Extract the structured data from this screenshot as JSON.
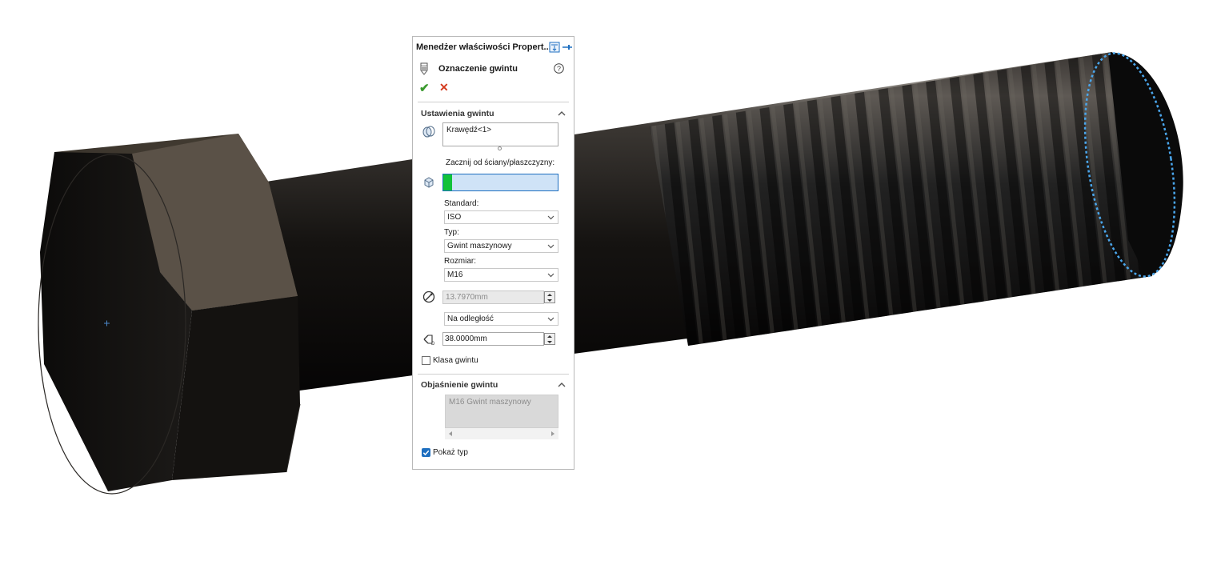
{
  "panel": {
    "title": "Menedżer właściwości Propert...",
    "feature_title": "Oznaczenie gwintu",
    "ok_label": "✔",
    "cancel_label": "✕",
    "thread_settings": {
      "section_title": "Ustawienia gwintu",
      "edge_selection": "Krawędź<1>",
      "start_label": "Zacznij od ściany/płaszczyzny:",
      "start_value": "",
      "standard_label": "Standard:",
      "standard_value": "ISO",
      "type_label": "Typ:",
      "type_value": "Gwint maszynowy",
      "size_label": "Rozmiar:",
      "size_value": "M16",
      "minor_diameter": "13.7970mm",
      "end_condition": "Na odległość",
      "depth": "38.0000mm",
      "class_label": "Klasa gwintu",
      "class_checked": false
    },
    "callout": {
      "section_title": "Objaśnienie gwintu",
      "text": "M16 Gwint maszynowy",
      "show_type_label": "Pokaż typ",
      "show_type_checked": true
    }
  },
  "colors": {
    "accent_blue": "#1e6fc0",
    "ok_green": "#3a9a2e",
    "cancel_red": "#d43a1e",
    "selection_green": "#12c23a",
    "selection_fill": "#cfe3f7",
    "edge_highlight": "#4aa6ec"
  }
}
